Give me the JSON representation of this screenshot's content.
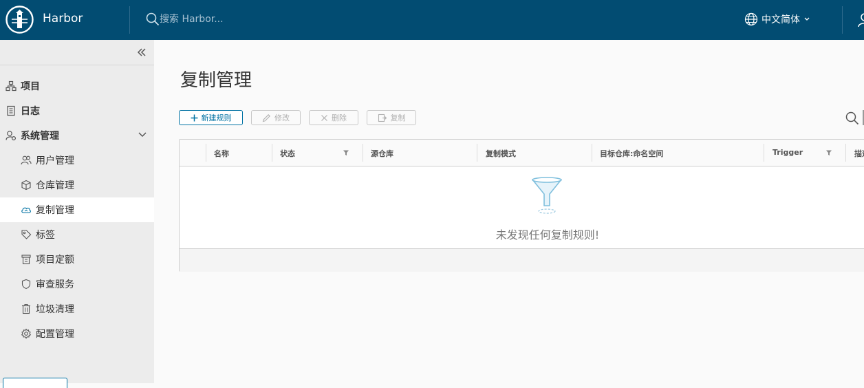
{
  "header": {
    "app_title": "Harbor",
    "search_placeholder": "搜索 Harbor...",
    "language": "中文简体",
    "bg_color": "#024c72"
  },
  "sidebar": {
    "items": [
      {
        "label": "项目",
        "icon": "projects-icon"
      },
      {
        "label": "日志",
        "icon": "logs-icon"
      },
      {
        "label": "系统管理",
        "icon": "administration-icon",
        "expanded": true
      }
    ],
    "sub_items": [
      {
        "label": "用户管理",
        "icon": "users-icon"
      },
      {
        "label": "仓库管理",
        "icon": "registries-icon"
      },
      {
        "label": "复制管理",
        "icon": "replication-icon",
        "active": true
      },
      {
        "label": "标签",
        "icon": "tag-icon"
      },
      {
        "label": "项目定额",
        "icon": "quota-icon"
      },
      {
        "label": "审查服务",
        "icon": "shield-icon"
      },
      {
        "label": "垃圾清理",
        "icon": "trash-icon"
      },
      {
        "label": "配置管理",
        "icon": "gear-icon"
      }
    ]
  },
  "main": {
    "page_title": "复制管理",
    "toolbar": {
      "new_rule": "新建规则",
      "edit": "修改",
      "delete": "删除",
      "copy": "复制"
    },
    "table": {
      "columns": [
        {
          "label": "名称",
          "filter": false
        },
        {
          "label": "状态",
          "filter": true
        },
        {
          "label": "源仓库",
          "filter": false
        },
        {
          "label": "复制模式",
          "filter": false
        },
        {
          "label": "目标仓库:命名空间",
          "filter": false
        },
        {
          "label": "Trigger",
          "filter": true
        },
        {
          "label": "描述",
          "filter": false
        }
      ],
      "empty_message": "未发现任何复制规则!"
    }
  },
  "colors": {
    "accent": "#0072a3",
    "sidebar_bg": "#ececec"
  }
}
